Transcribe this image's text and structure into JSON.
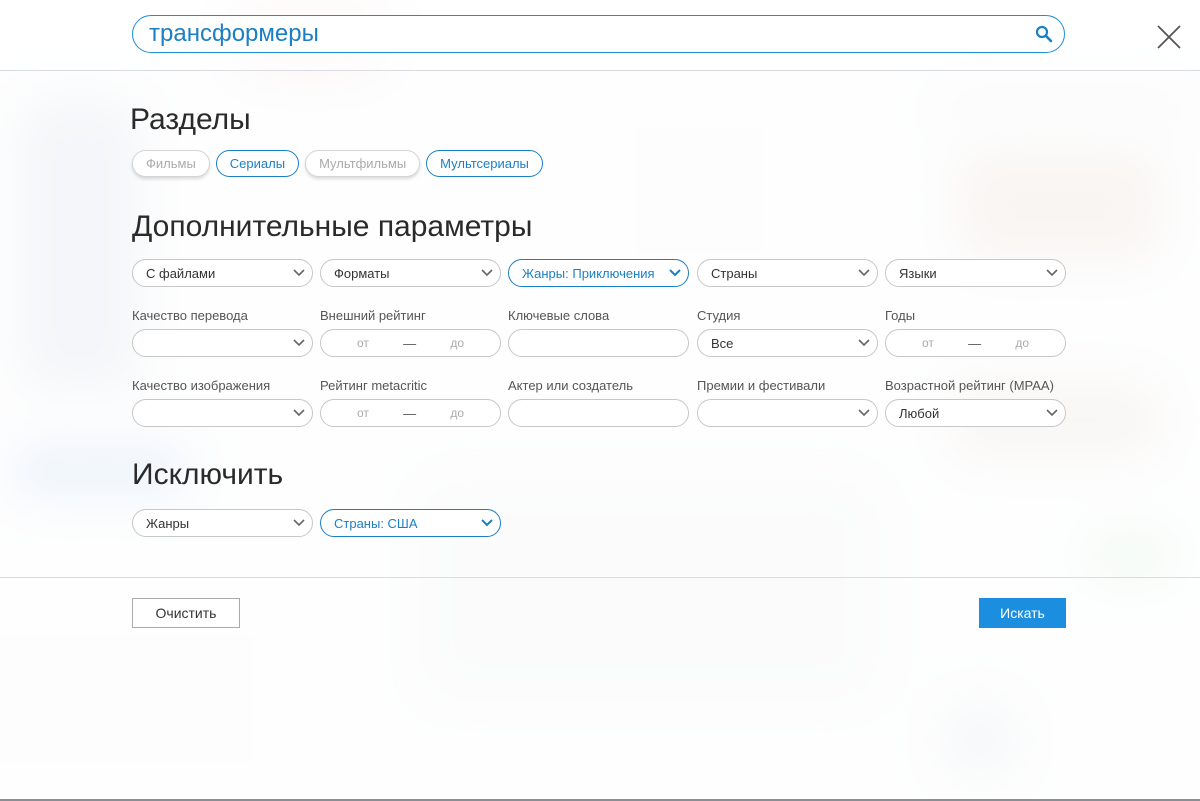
{
  "search": {
    "query": "трансформеры"
  },
  "sections": {
    "title": "Разделы",
    "items": [
      {
        "label": "Фильмы",
        "selected": false
      },
      {
        "label": "Сериалы",
        "selected": true
      },
      {
        "label": "Мультфильмы",
        "selected": false
      },
      {
        "label": "Мультсериалы",
        "selected": true
      }
    ]
  },
  "params": {
    "title": "Дополнительные параметры",
    "row1": {
      "files": "С файлами",
      "formats": "Форматы",
      "genres": "Жанры: Приключения",
      "countries": "Страны",
      "languages": "Языки"
    },
    "row2": {
      "translation_label": "Качество перевода",
      "translation_value": "",
      "ext_rating_label": "Внешний рейтинг",
      "keywords_label": "Ключевые слова",
      "keywords_value": "",
      "studio_label": "Студия",
      "studio_value": "Все",
      "years_label": "Годы"
    },
    "row3": {
      "image_quality_label": "Качество изображения",
      "image_quality_value": "",
      "metacritic_label": "Рейтинг metacritic",
      "actor_label": "Актер или создатель",
      "actor_value": "",
      "awards_label": "Премии и фестивали",
      "awards_value": "",
      "mpaa_label": "Возрастной рейтинг (MPAA)",
      "mpaa_value": "Любой"
    },
    "range": {
      "from": "от",
      "dash": "—",
      "to": "до"
    }
  },
  "exclude": {
    "title": "Исключить",
    "genres": "Жанры",
    "countries": "Страны: США"
  },
  "actions": {
    "clear": "Очистить",
    "search": "Искать"
  },
  "colors": {
    "accent": "#1b7fc4",
    "button": "#1b8ee0"
  }
}
